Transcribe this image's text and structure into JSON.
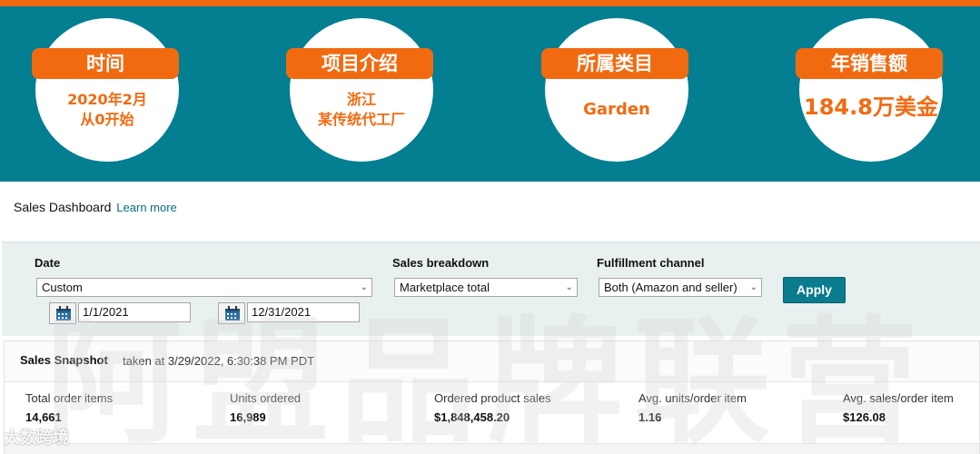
{
  "banner": {
    "cards": [
      {
        "title": "时间",
        "lines": [
          "2020年2月",
          "从0开始"
        ]
      },
      {
        "title": "项目介绍",
        "lines": [
          "浙江",
          "某传统代工厂"
        ]
      },
      {
        "title": "所属类目",
        "lines": [
          "Garden"
        ]
      },
      {
        "title": "年销售额",
        "lines": [
          "184.8万美金"
        ]
      }
    ]
  },
  "header": {
    "title": "Sales Dashboard",
    "learn_more": "Learn more"
  },
  "filters": {
    "date_label": "Date",
    "date_select": "Custom",
    "start_date": "1/1/2021",
    "end_date": "12/31/2021",
    "breakdown_label": "Sales breakdown",
    "breakdown_select": "Marketplace total",
    "channel_label": "Fulfillment channel",
    "channel_select": "Both (Amazon and seller)",
    "apply_label": "Apply"
  },
  "snapshot": {
    "title": "Sales Snapshot",
    "taken": "taken at 3/29/2022, 6:30:38 PM PDT",
    "metrics": [
      {
        "label": "Total order items",
        "value": "14,661"
      },
      {
        "label": "Units ordered",
        "value": "16,989"
      },
      {
        "label": "Ordered product sales",
        "value": "$1,848,458.20"
      },
      {
        "label": "Avg. units/order item",
        "value": "1.16"
      },
      {
        "label": "Avg. sales/order item",
        "value": "$126.08"
      }
    ]
  },
  "watermark": {
    "text": "阿盟品牌联营",
    "logo_text": "大数跨境"
  },
  "colors": {
    "teal": "#047e91",
    "orange": "#f26a10",
    "apply": "#0a7c8e"
  },
  "icons": {
    "calendar": "calendar-icon",
    "dropdown": "chevron-down-icon"
  }
}
